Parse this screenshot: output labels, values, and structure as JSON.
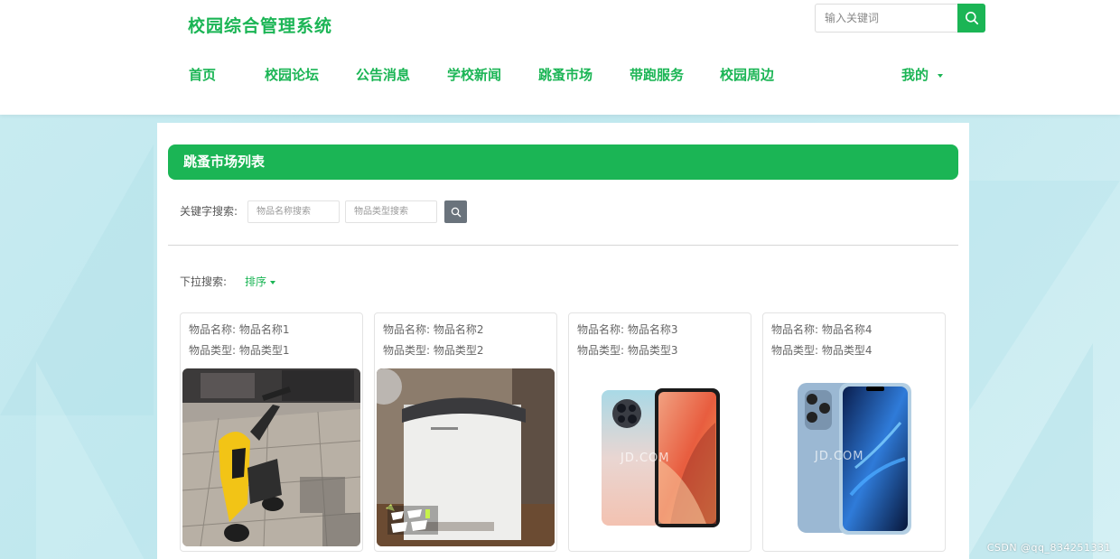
{
  "site": {
    "title": "校园综合管理系统"
  },
  "search": {
    "placeholder": "输入关键词"
  },
  "nav": {
    "items": [
      "首页",
      "校园论坛",
      "公告消息",
      "学校新闻",
      "跳蚤市场",
      "带跑服务",
      "校园周边"
    ],
    "mine": "我的"
  },
  "section": {
    "title": "跳蚤市场列表"
  },
  "filters": {
    "keyword_label": "关键字搜索:",
    "name_placeholder": "物品名称搜索",
    "type_placeholder": "物品类型搜索",
    "dropdown_label": "下拉搜索:",
    "sort_label": "排序"
  },
  "items": [
    {
      "name_line": "物品名称: 物品名称1",
      "type_line": "物品类型: 物品类型1",
      "image": "yellow-scooter"
    },
    {
      "name_line": "物品名称: 物品名称2",
      "type_line": "物品类型: 物品类型2",
      "image": "white-appliance"
    },
    {
      "name_line": "物品名称: 物品名称3",
      "type_line": "物品类型: 物品类型3",
      "image": "redmi-phone"
    },
    {
      "name_line": "物品名称: 物品名称4",
      "type_line": "物品类型: 物品类型4",
      "image": "iphone-blue"
    }
  ],
  "watermark": "CSDN @qq_834251331",
  "colors": {
    "accent": "#1bb555",
    "search_btn": "#6a737c"
  }
}
